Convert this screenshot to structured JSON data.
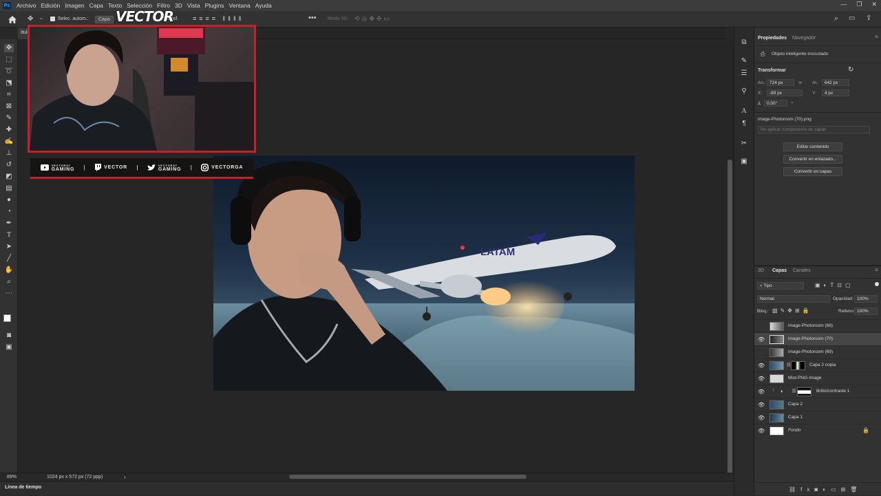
{
  "app": {
    "logo": "Ps"
  },
  "menu": [
    "Archivo",
    "Edición",
    "Imagen",
    "Capa",
    "Texto",
    "Selección",
    "Filtro",
    "3D",
    "Vista",
    "Plugins",
    "Ventana",
    "Ayuda"
  ],
  "options_bar": {
    "auto_select": "Selec. autom.:",
    "auto_select_target": "Capa",
    "transform": "transf.",
    "mode_3d": "Modo 3D:"
  },
  "document_tab": {
    "title": "ítulo"
  },
  "overlay": {
    "brand": "VECTOR",
    "socials": [
      {
        "icon": "youtube-icon",
        "small": "VECTORAT",
        "name": "GAMING"
      },
      {
        "icon": "twitch-icon",
        "small": "",
        "name": "VECTOR"
      },
      {
        "icon": "twitter-icon",
        "small": "VECTORAT",
        "name": "GAMING"
      },
      {
        "icon": "instagram-icon",
        "small": "",
        "name": "VECTORGA"
      }
    ]
  },
  "canvas": {
    "plane_livery": "LATAM"
  },
  "status": {
    "zoom": "89%",
    "doc_info": "1024 px x 572 px (72 ppp)"
  },
  "timeline_label": "Línea de tiempo",
  "properties": {
    "tabs": [
      "Propiedades",
      "Navegador"
    ],
    "object_type": "Objeto inteligente incrustado",
    "transform_title": "Transformar",
    "width_label": "An.:",
    "width": "724 px",
    "height_label": "Al.:",
    "height": "642 px",
    "x_label": "X:",
    "x": "-89 px",
    "y_label": "Y:",
    "y": "4 px",
    "angle": "0,00°",
    "filename": "image-Photoroom (70).png",
    "layer_comp_placeholder": "No aplicar composición de capas",
    "buttons": [
      "Editar contenido",
      "Convertir en enlazado...",
      "Convertir en capas"
    ]
  },
  "layers_panel": {
    "tabs": [
      "3D",
      "Capas",
      "Canales"
    ],
    "filter": "Tipo",
    "blend_mode": "Normal",
    "opacity_label": "Opacidad:",
    "opacity": "100%",
    "lock_label": "Bloq.:",
    "fill_label": "Relleno:",
    "fill": "100%",
    "layers": [
      {
        "name": "image-Photoroom (68)",
        "visible": false,
        "selected": false
      },
      {
        "name": "image-Photoroom (70)",
        "visible": true,
        "selected": true
      },
      {
        "name": "image-Photoroom (69)",
        "visible": false,
        "selected": false
      },
      {
        "name": "Capa 2 copia",
        "visible": true,
        "selected": false
      },
      {
        "name": "Mist-PNG-Image",
        "visible": true,
        "selected": false
      },
      {
        "name": "Brillo/contraste 1",
        "visible": true,
        "selected": false
      },
      {
        "name": "Capa 2",
        "visible": true,
        "selected": false
      },
      {
        "name": "Capa 1",
        "visible": true,
        "selected": false
      },
      {
        "name": "Fondo",
        "visible": true,
        "selected": false
      }
    ]
  }
}
